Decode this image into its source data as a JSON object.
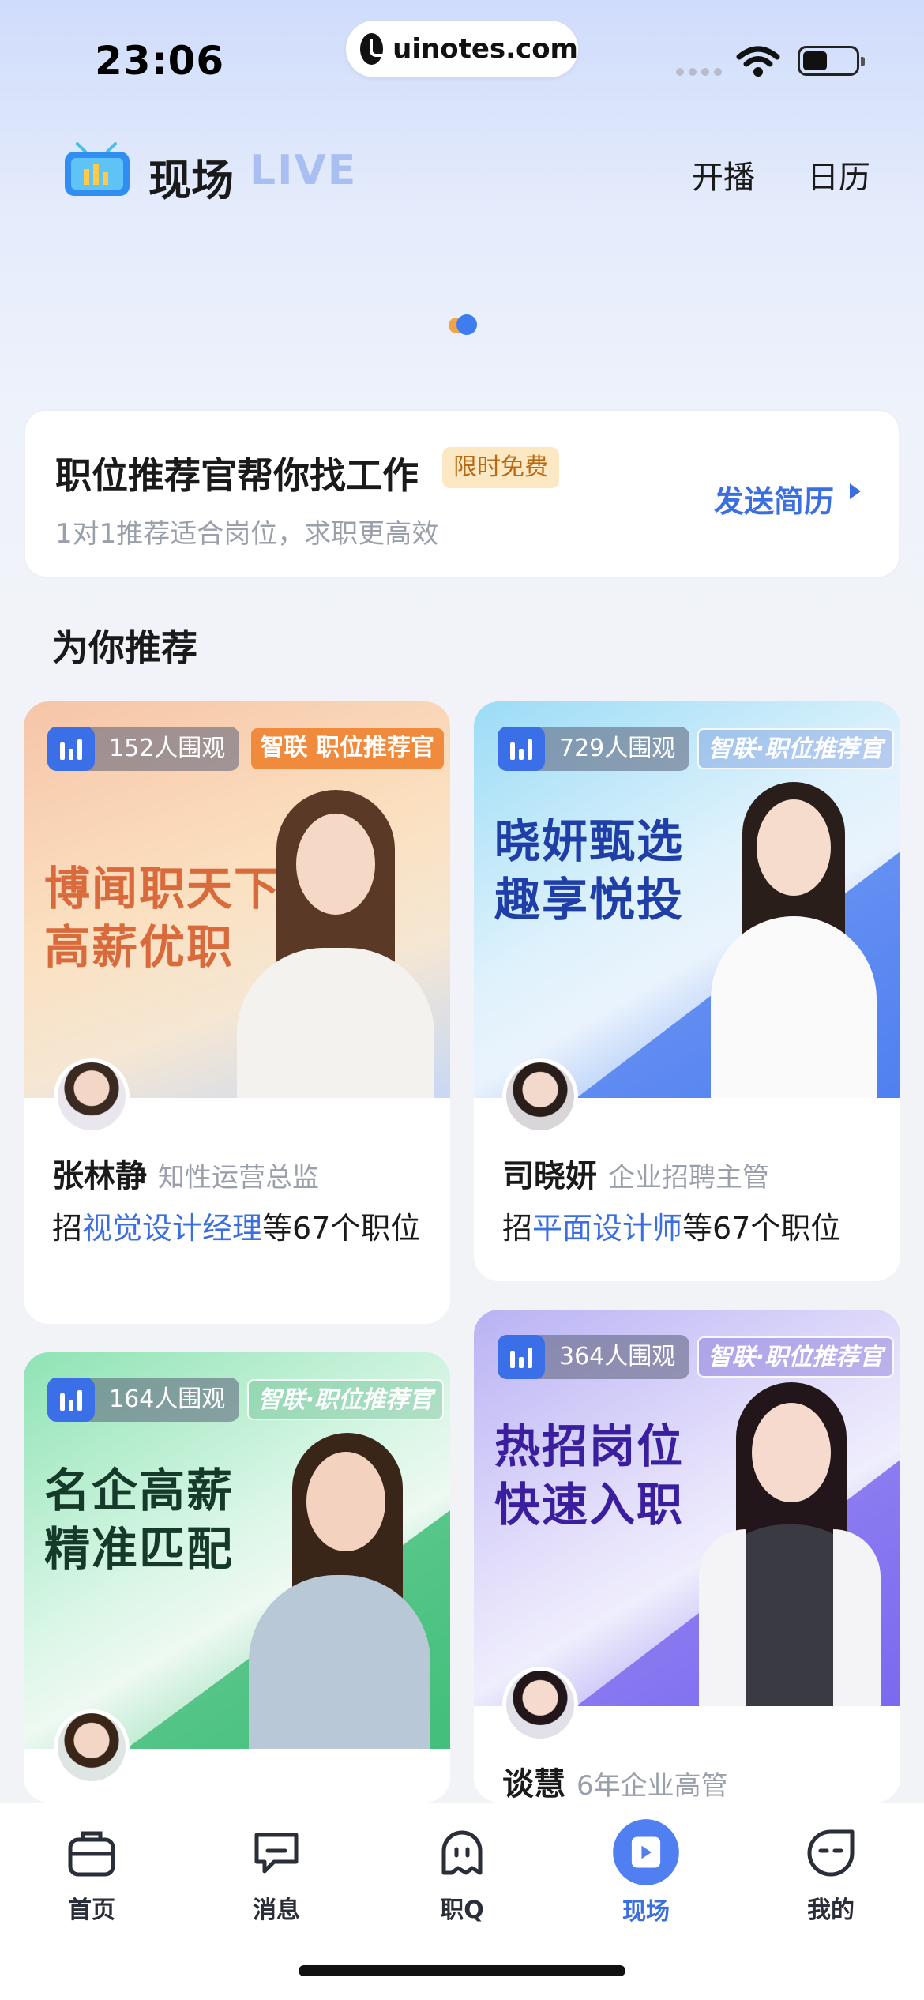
{
  "status_bar": {
    "time": "23:06",
    "url": "uinotes.com"
  },
  "header": {
    "title": "现场",
    "title_live": "LIVE",
    "broadcast_label": "开播",
    "calendar_label": "日历"
  },
  "recommend_banner": {
    "title": "职位推荐官帮你找工作",
    "badge": "限时免费",
    "subtitle": "1对1推荐适合岗位，求职更高效",
    "cta": "发送简历"
  },
  "section_title": "为你推荐",
  "cards": [
    {
      "viewers": "152人围观",
      "brand_tag": "智联 职位推荐官",
      "slogan_line1": "博闻职天下",
      "slogan_line2": "高薪优职",
      "host_name": "张林静",
      "host_role": "知性运营总监",
      "job_prefix": "招",
      "job_highlight": "视觉设计经理",
      "job_suffix": "等67个职位"
    },
    {
      "viewers": "729人围观",
      "brand_tag": "智联·职位推荐官",
      "slogan_line1": "晓妍甄选",
      "slogan_line2": "趣享悦投",
      "host_name": "司晓妍",
      "host_role": "企业招聘主管",
      "job_prefix": "招",
      "job_highlight": "平面设计师",
      "job_suffix": "等67个职位"
    },
    {
      "viewers": "164人围观",
      "brand_tag": "智联·职位推荐官",
      "slogan_line1": "名企高薪",
      "slogan_line2": "精准匹配"
    },
    {
      "viewers": "364人围观",
      "brand_tag": "智联·职位推荐官",
      "slogan_line1": "热招岗位",
      "slogan_line2": "快速入职",
      "host_name": "谈慧",
      "host_role": "6年企业高管"
    }
  ],
  "tab_bar": {
    "home": "首页",
    "messages": "消息",
    "zhiq": "职Q",
    "live": "现场",
    "mine": "我的"
  },
  "colors": {
    "accent": "#3b6fe0",
    "badge_bg": "#fde8c4",
    "badge_text": "#b76a13"
  }
}
